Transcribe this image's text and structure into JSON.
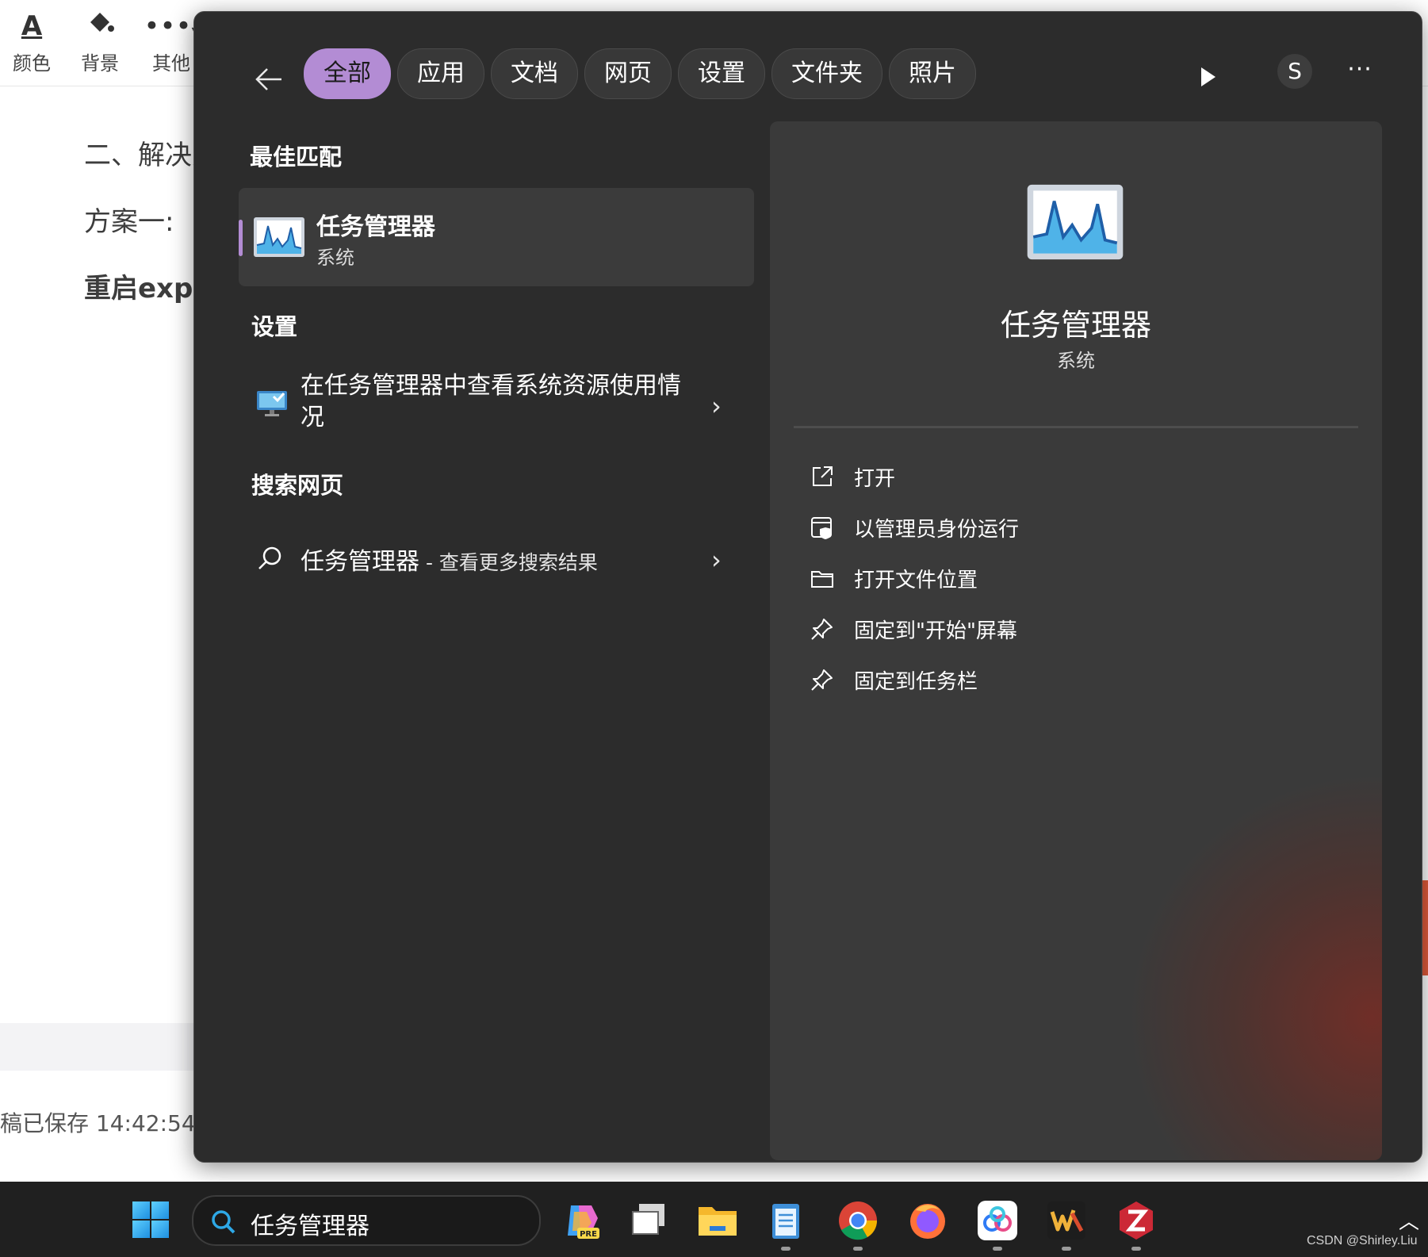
{
  "editor": {
    "toolbar": [
      {
        "label": "颜色",
        "icon": "font-color-icon"
      },
      {
        "label": "背景",
        "icon": "paint-bucket-icon"
      },
      {
        "label": "其他",
        "icon": "more-dots-icon"
      }
    ],
    "lines": [
      "二、解决方",
      "方案一:",
      "重启explo"
    ],
    "saved_status": "稿已保存 14:42:54"
  },
  "search": {
    "tabs": [
      "全部",
      "应用",
      "文档",
      "网页",
      "设置",
      "文件夹",
      "照片"
    ],
    "active_tab": "全部",
    "avatar_letter": "S",
    "best_match": {
      "heading": "最佳匹配",
      "name": "任务管理器",
      "type": "系统"
    },
    "settings": {
      "heading": "设置",
      "item": "在任务管理器中查看系统资源使用情况"
    },
    "web": {
      "heading": "搜索网页",
      "query": "任务管理器",
      "more": " - 查看更多搜索结果"
    },
    "detail": {
      "title": "任务管理器",
      "subtitle": "系统",
      "actions": [
        {
          "label": "打开",
          "icon": "open-external-icon"
        },
        {
          "label": "以管理员身份运行",
          "icon": "run-as-admin-icon"
        },
        {
          "label": "打开文件位置",
          "icon": "folder-icon"
        },
        {
          "label": "固定到\"开始\"屏幕",
          "icon": "pin-icon"
        },
        {
          "label": "固定到任务栏",
          "icon": "pin-icon"
        }
      ]
    }
  },
  "taskbar": {
    "search_value": "任务管理器",
    "apps": [
      "copilot-pre-icon",
      "task-view-icon",
      "file-explorer-icon",
      "notepad-icon",
      "chrome-icon",
      "firefox-icon",
      "baidu-netdisk-icon",
      "wps-icon",
      "zotero-icon"
    ],
    "copilot_badge": "PRE"
  },
  "watermark": "CSDN @Shirley.Liu",
  "colors": {
    "accent": "#b38cd4",
    "flyout_bg": "#2c2c2c",
    "detail_bg": "#3a3a3a",
    "taskbar_bg": "#202020"
  }
}
